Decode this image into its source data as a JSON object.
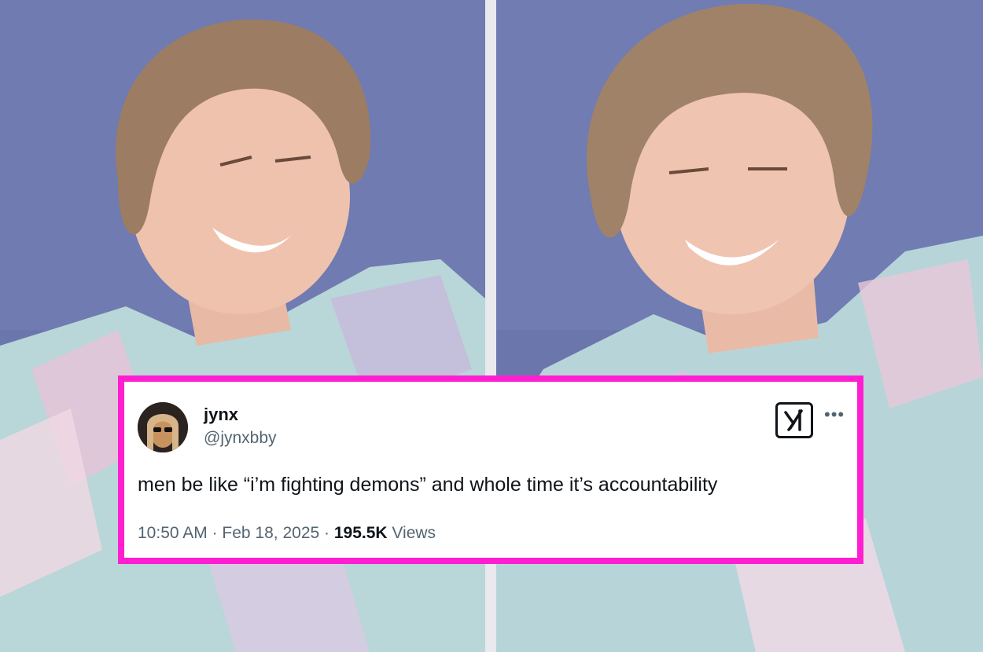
{
  "tweet": {
    "display_name": "jynx",
    "handle": "@jynxbby",
    "text": "men be like “i’m fighting demons” and whole time it’s accountability",
    "time": "10:50 AM",
    "separator_1": " · ",
    "date": "Feb 18, 2025",
    "separator_2": " · ",
    "views_count": "195.5K",
    "views_label": " Views",
    "more_icon": "more-options-icon",
    "logo_icon": "x-grok-logo-icon"
  },
  "colors": {
    "border_accent": "#ff1fd0",
    "background_blue": "#6a75ac",
    "text_primary": "#0f1419",
    "text_secondary": "#536471"
  }
}
